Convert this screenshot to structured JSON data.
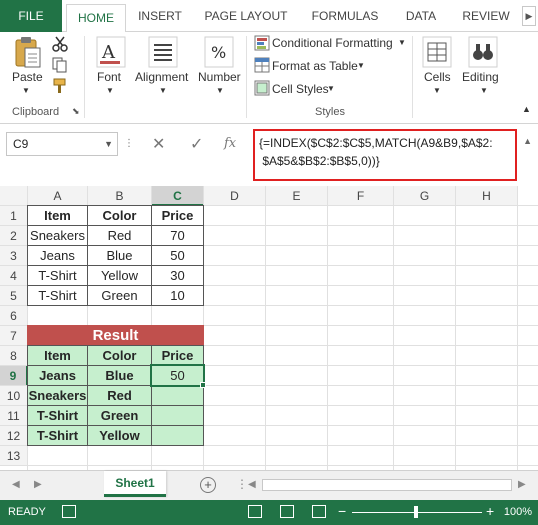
{
  "tabs": {
    "file": "FILE",
    "home": "HOME",
    "insert": "INSERT",
    "page_layout": "PAGE LAYOUT",
    "formulas": "FORMULAS",
    "data": "DATA",
    "review": "REVIEW"
  },
  "ribbon": {
    "paste": "Paste",
    "font": "Font",
    "alignment": "Alignment",
    "number": "Number",
    "conditional_formatting": "Conditional Formatting",
    "format_as_table": "Format as Table",
    "cell_styles": "Cell Styles",
    "cells": "Cells",
    "editing": "Editing",
    "clipboard": "Clipboard",
    "styles": "Styles"
  },
  "formula_bar": {
    "name_box": "C9",
    "cancel_icon": "✕",
    "enter_icon": "✓",
    "fx_icon": "fx",
    "formula": "{=INDEX($C$2:$C$5,MATCH(A9&B9,$A$2:\n $A$5&$B$2:$B$5,0))}"
  },
  "grid": {
    "columns": [
      "A",
      "B",
      "C",
      "D",
      "E",
      "F",
      "G",
      "H"
    ],
    "rows": [
      "1",
      "2",
      "3",
      "4",
      "5",
      "6",
      "7",
      "8",
      "9",
      "10",
      "11",
      "12",
      "13"
    ],
    "source_headers": [
      "Item",
      "Color",
      "Price"
    ],
    "source_rows": [
      [
        "Sneakers",
        "Red",
        "70"
      ],
      [
        "Jeans",
        "Blue",
        "50"
      ],
      [
        "T-Shirt",
        "Yellow",
        "30"
      ],
      [
        "T-Shirt",
        "Green",
        "10"
      ]
    ],
    "result_title": "Result",
    "result_headers": [
      "Item",
      "Color",
      "Price"
    ],
    "result_rows": [
      [
        "Jeans",
        "Blue",
        "50"
      ],
      [
        "Sneakers",
        "Red",
        ""
      ],
      [
        "T-Shirt",
        "Green",
        ""
      ],
      [
        "T-Shirt",
        "Yellow",
        ""
      ]
    ],
    "selected_cell": "C9"
  },
  "sheets": {
    "active": "Sheet1",
    "add": "+"
  },
  "status": {
    "ready": "READY",
    "zoom": "100%",
    "zoom_minus": "−",
    "zoom_plus": "+"
  },
  "colors": {
    "accent": "#217346",
    "result_header": "#c0504d",
    "result_fill": "#c6efce",
    "formula_highlight": "#e02020"
  }
}
